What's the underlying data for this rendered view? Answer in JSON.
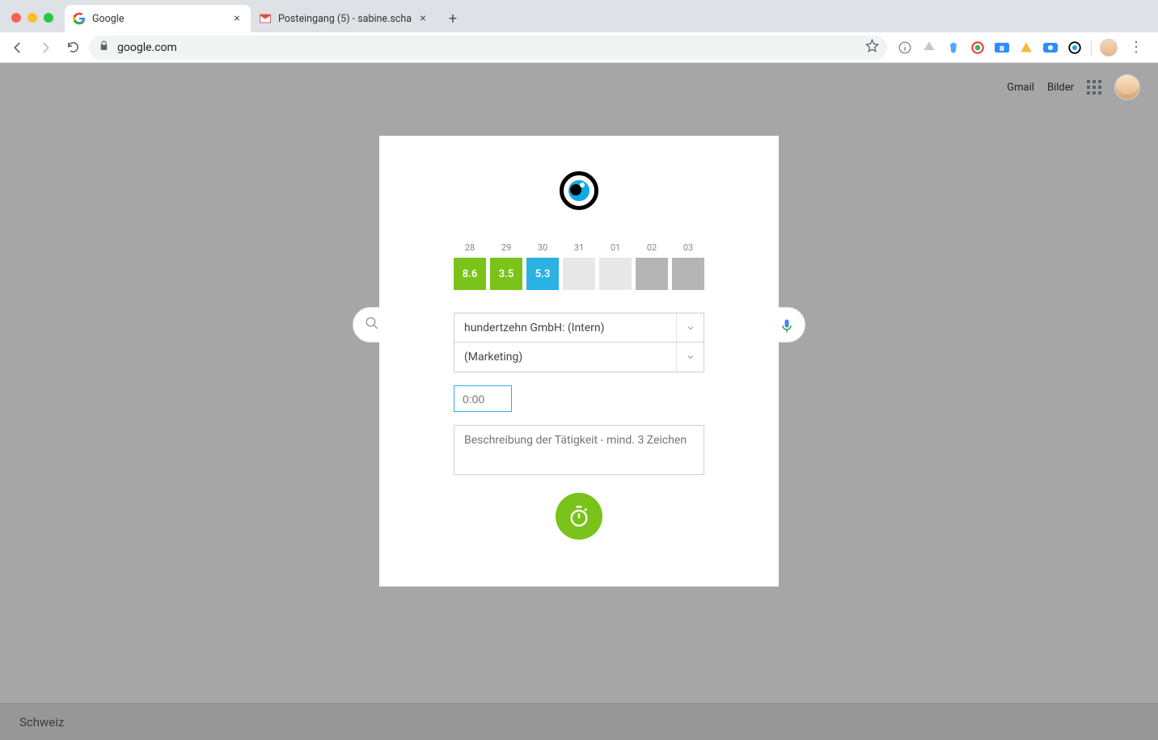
{
  "browser": {
    "tabs": [
      {
        "title": "Google",
        "favicon": "google"
      },
      {
        "title": "Posteingang (5) - sabine.scha",
        "favicon": "gmail"
      }
    ],
    "url": "google.com"
  },
  "header": {
    "gmail": "Gmail",
    "bilder": "Bilder"
  },
  "footer": {
    "country": "Schweiz"
  },
  "modal": {
    "days": [
      {
        "num": "28",
        "val": "8.6",
        "style": "green"
      },
      {
        "num": "29",
        "val": "3.5",
        "style": "green"
      },
      {
        "num": "30",
        "val": "5.3",
        "style": "blue"
      },
      {
        "num": "31",
        "val": "",
        "style": "lg"
      },
      {
        "num": "01",
        "val": "",
        "style": "lg"
      },
      {
        "num": "02",
        "val": "",
        "style": "dg"
      },
      {
        "num": "03",
        "val": "",
        "style": "dg"
      }
    ],
    "select_client": "hundertzehn GmbH: (Intern)",
    "select_project": "(Marketing)",
    "time_placeholder": "0:00",
    "desc_placeholder": "Beschreibung der Tätigkeit - mind. 3 Zeichen"
  }
}
